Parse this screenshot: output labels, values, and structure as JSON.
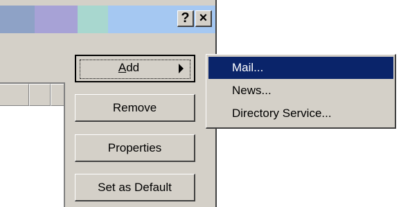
{
  "titlebar": {
    "help_label": "?",
    "close_label": "×"
  },
  "buttons": {
    "add_label": "dd",
    "add_accel": "A",
    "remove_label": "Remove",
    "properties_label": "Properties",
    "default_label": "Set as Default"
  },
  "menu": {
    "items": [
      {
        "label": "Mail...",
        "selected": true
      },
      {
        "label": "News..."
      },
      {
        "label": "Directory Service..."
      }
    ]
  },
  "colors": {
    "face": "#d4d0c8",
    "highlight": "#0a246a"
  }
}
